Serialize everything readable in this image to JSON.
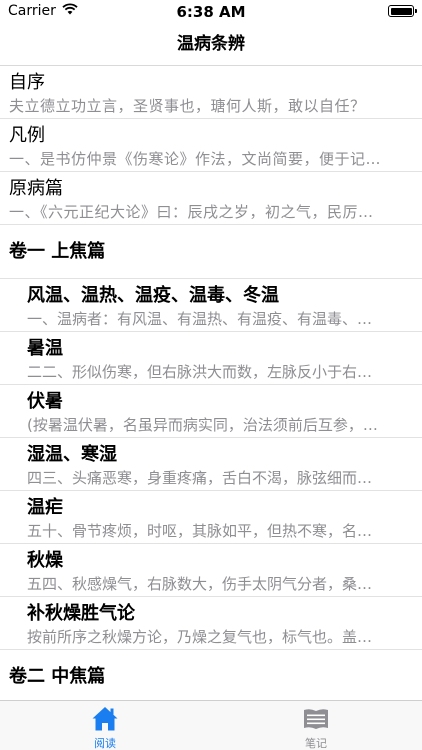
{
  "status_bar": {
    "carrier": "Carrier",
    "time": "6:38 AM"
  },
  "nav": {
    "title": "温病条辨"
  },
  "preface_items": [
    {
      "title": "自序",
      "subtitle": "夫立德立功立言，圣贤事也，瑭何人斯，敢以自任？"
    },
    {
      "title": "凡例",
      "subtitle": "一、是书仿仲景《伤寒论》作法，文尚简要，便于记…"
    },
    {
      "title": "原病篇",
      "subtitle": "一、《六元正纪大论》曰：辰戌之岁，初之气，民厉…"
    }
  ],
  "volume1": {
    "header": "卷一 上焦篇",
    "items": [
      {
        "title": "风温、温热、温疫、温毒、冬温",
        "subtitle": "一、温病者：有风温、有温热、有温疫、有温毒、…"
      },
      {
        "title": "暑温",
        "subtitle": "二二、形似伤寒，但右脉洪大而数，左脉反小于右…"
      },
      {
        "title": "伏暑",
        "subtitle": "(按暑温伏暑，名虽异而病实同，治法须前后互参，…"
      },
      {
        "title": "湿温、寒湿",
        "subtitle": "四三、头痛恶寒，身重疼痛，舌白不渴，脉弦细而…"
      },
      {
        "title": "温疟",
        "subtitle": "五十、骨节疼烦，时呕，其脉如平，但热不寒，名…"
      },
      {
        "title": "秋燥",
        "subtitle": "五四、秋感燥气，右脉数大，伤手太阴气分者，桑…"
      },
      {
        "title": "补秋燥胜气论",
        "subtitle": "按前所序之秋燥方论，乃燥之复气也，标气也。盖…"
      }
    ]
  },
  "volume2": {
    "header": "卷二 中焦篇"
  },
  "tabs": {
    "read_label": "阅读",
    "notes_label": "笔记"
  },
  "colors": {
    "accent": "#1a7ef0",
    "inactive": "#8e8e93"
  }
}
